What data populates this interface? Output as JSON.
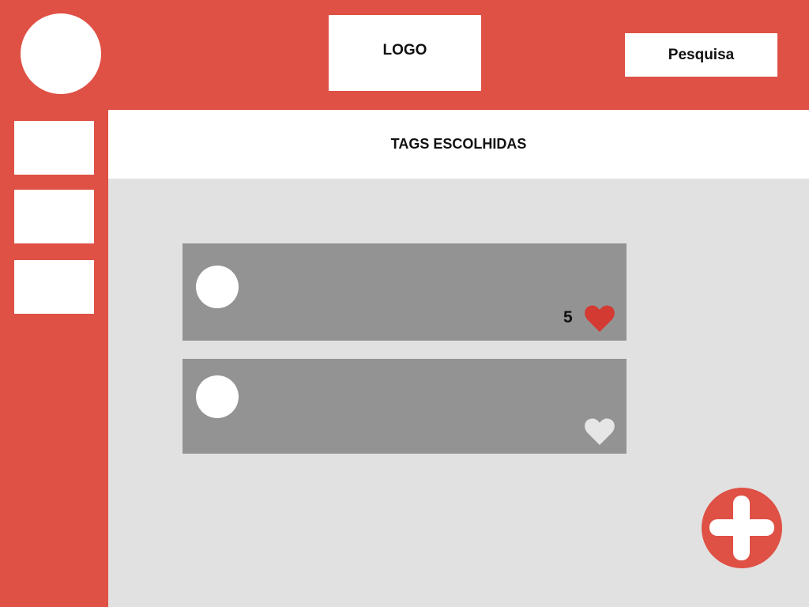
{
  "header": {
    "logo_label": "LOGO",
    "search_label": "Pesquisa"
  },
  "banner": {
    "title": "TAGS ESCOLHIDAS"
  },
  "sidebar": {
    "items": [
      {
        "label": ""
      },
      {
        "label": ""
      },
      {
        "label": ""
      }
    ]
  },
  "posts": [
    {
      "like_count": "5",
      "liked": true,
      "heart_icon": "heart-filled-icon"
    },
    {
      "like_count": "",
      "liked": false,
      "heart_icon": "heart-outline-icon"
    }
  ],
  "fab": {
    "icon": "plus-icon"
  },
  "colors": {
    "brand_red": "#df5045",
    "background_gray": "#e1e1e1",
    "card_gray": "#939393",
    "heart_liked": "#d33a32",
    "heart_unliked": "#e6e6e6"
  }
}
